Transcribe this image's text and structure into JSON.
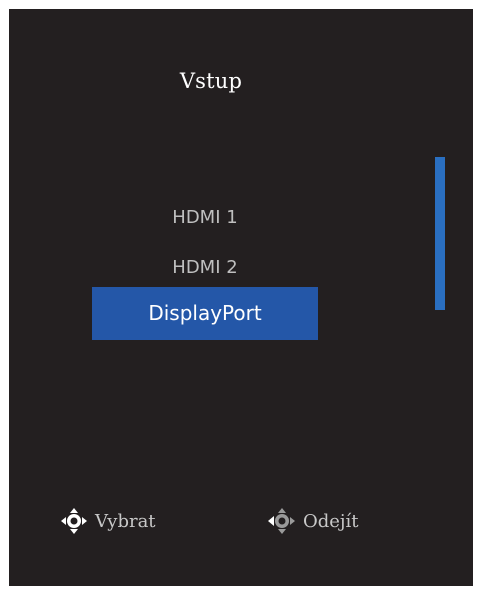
{
  "menu": {
    "title": "Vstup",
    "items": [
      {
        "label": "HDMI 1"
      },
      {
        "label": "HDMI 2"
      },
      {
        "label": "DisplayPort"
      }
    ],
    "selected_index": 2,
    "scroll_position": 0.5
  },
  "footer": {
    "select_label": "Vybrat",
    "select_icon": "joystick-select-icon",
    "exit_label": "Odejít",
    "exit_icon": "joystick-back-icon"
  },
  "colors": {
    "background": "#231f20",
    "highlight": "#2457a8",
    "scrollbar": "#2a6fc1"
  }
}
